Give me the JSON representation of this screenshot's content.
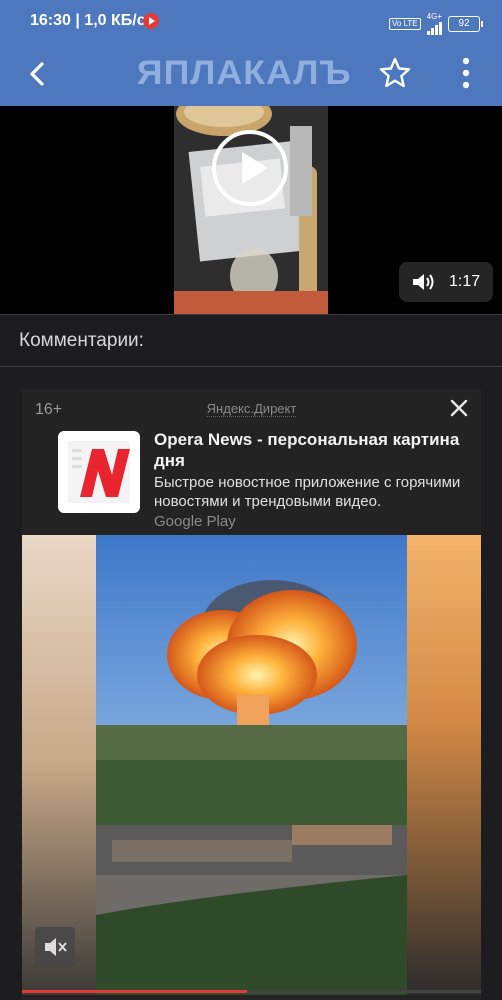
{
  "status_bar": {
    "time": "16:30",
    "speed": "1,0 КБ/с",
    "volte": "Vo LTE",
    "network": "4G+",
    "battery": "92"
  },
  "app_bar": {
    "logo": "ЯПЛАКАЛЪ",
    "back_icon": "arrow-left-icon",
    "favorite_icon": "star-outline-icon",
    "menu_icon": "more-vert-icon"
  },
  "video": {
    "duration": "1:17",
    "play_icon": "play-icon",
    "volume_icon": "volume-icon"
  },
  "comments": {
    "title": "Комментарии:"
  },
  "ad": {
    "age": "16+",
    "source": "Яндекс.Директ",
    "title": "Opera News - персональная картина дня",
    "description": "Быстрое новостное приложение с горячими новостями и трендовыми видео.",
    "store": "Google Play",
    "progress": 0.49,
    "colors": {
      "accent": "#e53935",
      "header": "#4d78bd"
    }
  }
}
